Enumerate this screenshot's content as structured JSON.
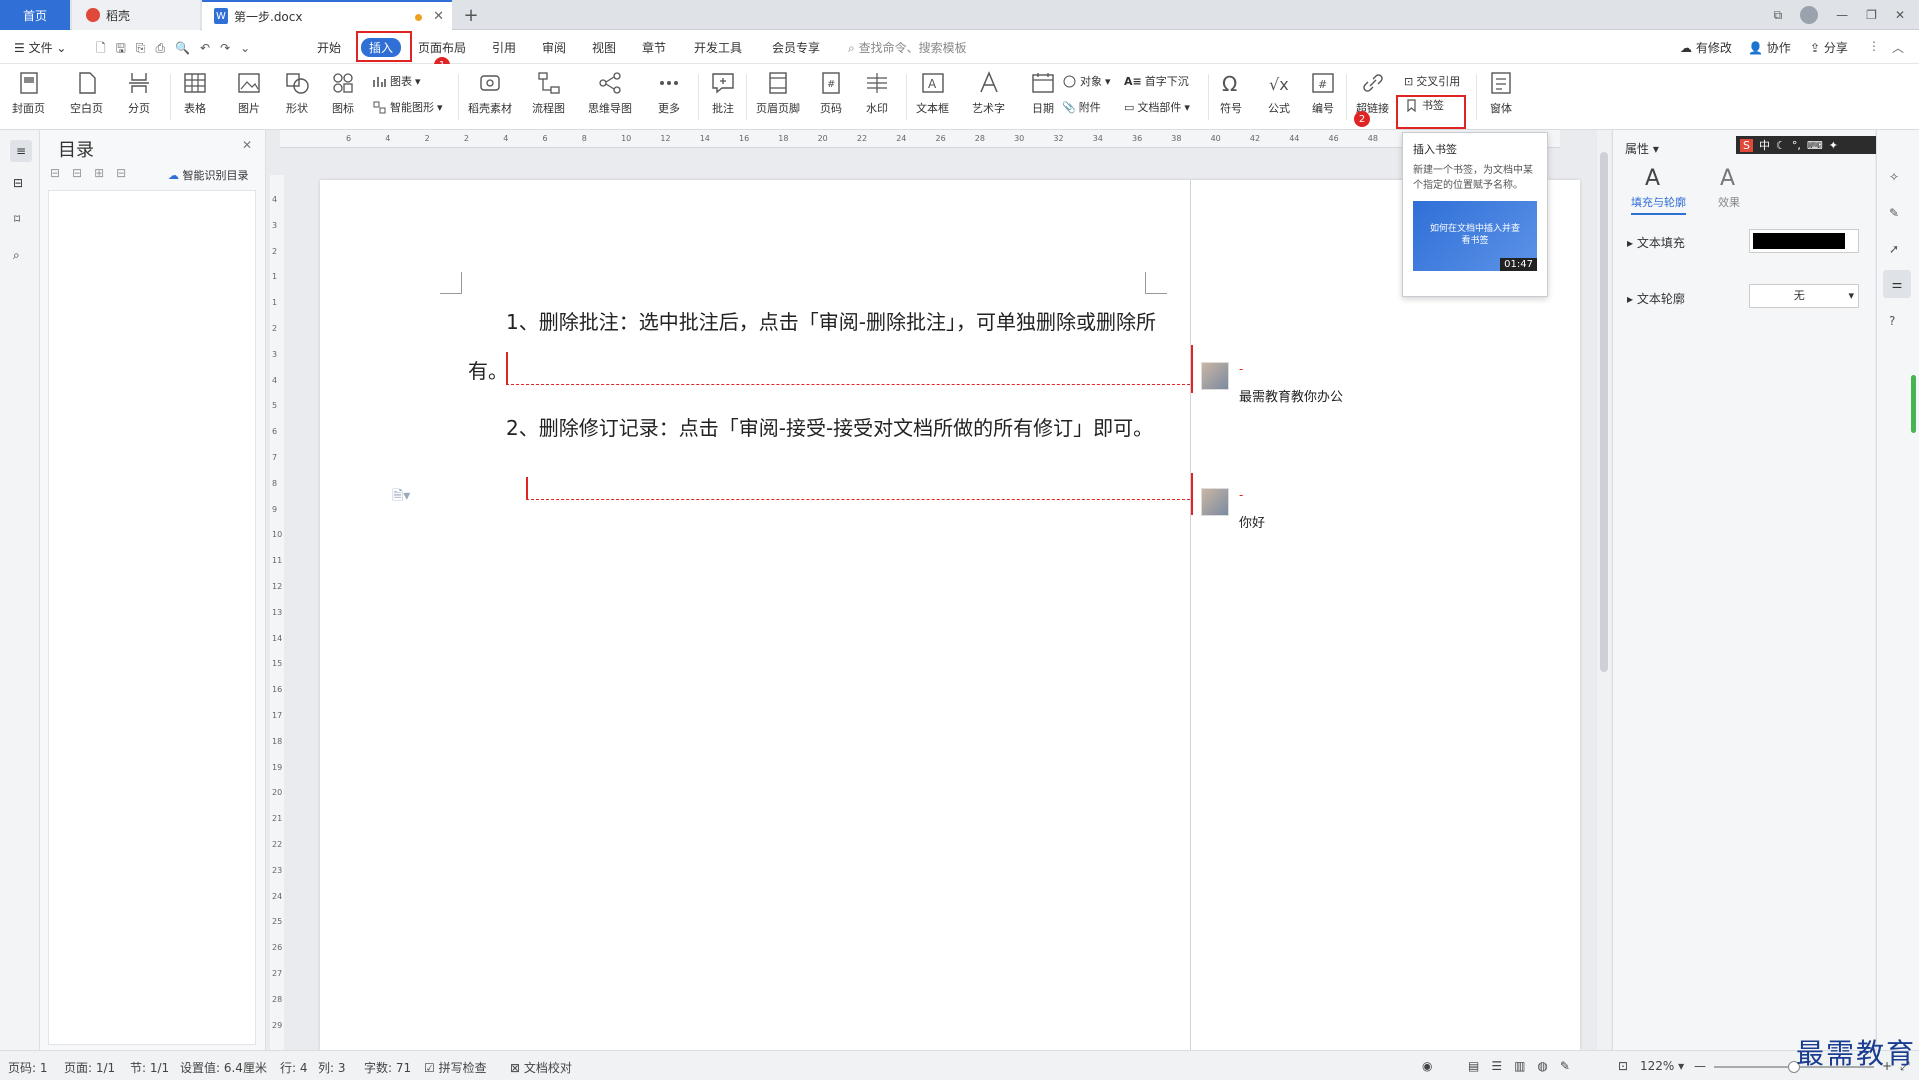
{
  "tabs": {
    "home": "首页",
    "daoke": "稻壳",
    "doc": "第一步.docx"
  },
  "menu": {
    "file": "文件",
    "items": [
      "开始",
      "插入",
      "页面布局",
      "引用",
      "审阅",
      "视图",
      "章节",
      "开发工具",
      "会员专享"
    ],
    "search_placeholder": "查找命令、搜索模板",
    "right": [
      "有修改",
      "协作",
      "分享"
    ]
  },
  "ribbon": {
    "cover": "封面页",
    "blank": "空白页",
    "pagebreak": "分页",
    "table": "表格",
    "picture": "图片",
    "shape": "形状",
    "icon": "图标",
    "chart": "图表",
    "smart": "智能图形",
    "material": "稻壳素材",
    "flow": "流程图",
    "mind": "思维导图",
    "more": "更多",
    "comment": "批注",
    "headerfooter": "页眉页脚",
    "pagenum": "页码",
    "watermark": "水印",
    "textbox": "文本框",
    "wordart": "艺术字",
    "date": "日期",
    "object": "对象",
    "attach": "附件",
    "dropcap": "首字下沉",
    "docpart": "文档部件",
    "symbol": "符号",
    "formula": "公式",
    "number": "编号",
    "hyperlink": "超链接",
    "crossref": "交叉引用",
    "bookmark": "书签",
    "window": "窗体"
  },
  "badges": [
    "1",
    "2"
  ],
  "toc": {
    "title": "目录",
    "smart": "智能识别目录"
  },
  "ruler": {
    "h": [
      "6",
      "4",
      "2",
      "2",
      "4",
      "6",
      "8",
      "10",
      "12",
      "14",
      "16",
      "18",
      "20",
      "22",
      "24",
      "26",
      "28",
      "30",
      "32",
      "34",
      "36",
      "38",
      "40",
      "42",
      "44",
      "46",
      "48",
      "50",
      "52",
      "54",
      "56"
    ],
    "v": [
      "4",
      "3",
      "2",
      "1",
      "1",
      "2",
      "3",
      "4",
      "5",
      "6",
      "7",
      "8",
      "9",
      "10",
      "11",
      "12",
      "13",
      "14",
      "15",
      "16",
      "17",
      "18",
      "19",
      "20",
      "21",
      "22",
      "23",
      "24",
      "25",
      "26",
      "27",
      "28",
      "29"
    ]
  },
  "doc": {
    "line1": "1、删除批注：选中批注后，点击「审阅-删除批注」，可单独删除或删除所",
    "line2": "有。",
    "line3": "2、删除修订记录：点击「审阅-接受-接受对文档所做的所有修订」即可。"
  },
  "comments": [
    {
      "author": "-",
      "text": "最需教育教你办公"
    },
    {
      "author": "-",
      "text": "你好"
    }
  ],
  "tooltip": {
    "title": "插入书签",
    "desc": "新建一个书签，为文档中某个指定的位置赋予名称。",
    "video_title": "如何在文档中插入并查看书签",
    "video_time": "01:47"
  },
  "props": {
    "title": "属性",
    "tab_fill": "填充与轮廓",
    "tab_effect": "效果",
    "text_fill": "文本填充",
    "text_outline": "文本轮廓",
    "outline_value": "无",
    "fill_color": "#000000"
  },
  "ime": "中",
  "status": {
    "page": "页码: 1",
    "pages": "页面: 1/1",
    "section": "节: 1/1",
    "setting": "设置值: 6.4厘米",
    "row": "行: 4",
    "col": "列: 3",
    "words": "字数: 71",
    "spell": "拼写检查",
    "proof": "文档校对",
    "zoom": "122%"
  },
  "watermark": "最需教育",
  "colors": {
    "accent": "#2f6fd6",
    "highlight": "#e02424"
  }
}
